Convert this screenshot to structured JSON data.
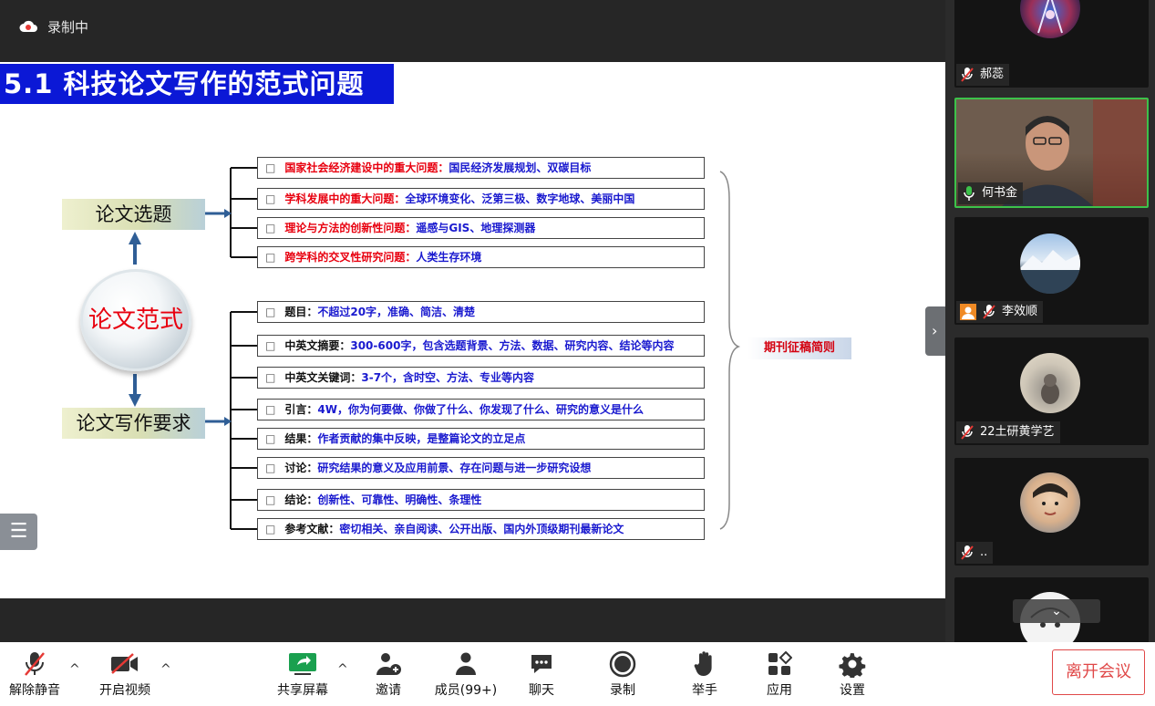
{
  "recording": {
    "label": "录制中"
  },
  "slide": {
    "title": "5.1  科技论文写作的范式问题",
    "center_label": "论文范式",
    "left_top_box": "论文选题",
    "left_bottom_box": "论文写作要求",
    "journal_box": "期刊征稿简则",
    "topic_items": [
      {
        "bullet": "□",
        "key": "国家社会经济建设中的重大问题：",
        "text": "国民经济发展规划、双碳目标"
      },
      {
        "bullet": "□",
        "key": "学科发展中的重大问题：",
        "text": "全球环境变化、泛第三极、数字地球、美丽中国"
      },
      {
        "bullet": "□",
        "key": "理论与方法的创新性问题：",
        "text": "遥感与GIS、地理探测器"
      },
      {
        "bullet": "□",
        "key": "跨学科的交叉性研究问题：",
        "text": "人类生存环境"
      }
    ],
    "writing_items": [
      {
        "bullet": "□",
        "key": "题目：",
        "text": "不超过20字，准确、简洁、清楚"
      },
      {
        "bullet": "□",
        "key": "中英文摘要：",
        "text": "300-600字，包含选题背景、方法、数据、研究内容、结论等内容"
      },
      {
        "bullet": "□",
        "key": "中英文关键词：",
        "text": "3-7个，含时空、方法、专业等内容"
      },
      {
        "bullet": "□",
        "key": "引言：",
        "text": "4W，你为何要做、你做了什么、你发现了什么、研究的意义是什么"
      },
      {
        "bullet": "□",
        "key": "结果：",
        "text": "作者贡献的集中反映，是整篇论文的立足点"
      },
      {
        "bullet": "□",
        "key": "讨论：",
        "text": "研究结果的意义及应用前景、存在问题与进一步研究设想"
      },
      {
        "bullet": "□",
        "key": "结论：",
        "text": "创新性、可靠性、明确性、条理性"
      },
      {
        "bullet": "□",
        "key": "参考文献：",
        "text": "密切相关、亲自阅读、公开出版、国内外顶级期刊最新论文"
      }
    ]
  },
  "participants": [
    {
      "name": "郝蕊",
      "muted": true
    },
    {
      "name": "何书金",
      "muted": false,
      "active": true
    },
    {
      "name": "李效顺",
      "muted": true
    },
    {
      "name": "22土研黄学艺",
      "muted": true
    },
    {
      "name": "..",
      "muted": true
    }
  ],
  "toolbar": {
    "unmute": "解除静音",
    "start_video": "开启视频",
    "share_screen": "共享屏幕",
    "invite": "邀请",
    "members": "成员(99+)",
    "chat": "聊天",
    "record": "录制",
    "raise_hand": "举手",
    "apps": "应用",
    "settings": "设置",
    "leave": "离开会议"
  },
  "colors": {
    "title_bg": "#0b18d6",
    "accent_red": "#e8000f",
    "active_border": "#3cc24a",
    "leave": "#e04848"
  }
}
